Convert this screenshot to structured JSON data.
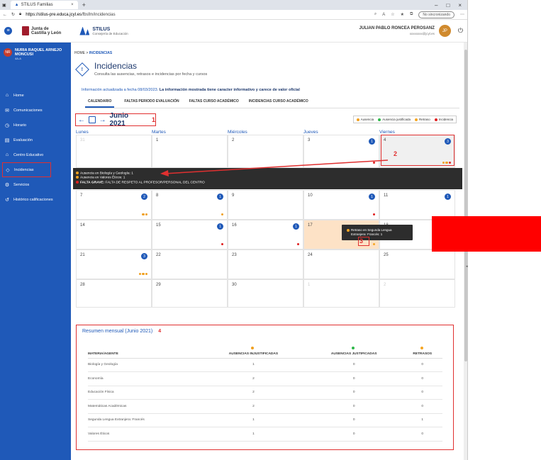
{
  "browser": {
    "tab_title": "STILUS Familias",
    "tab_close": "×",
    "new_tab": "+",
    "url_host": "https://stilus-pre.educa.jcyl.es",
    "url_path": "/fbsfm/incidencias",
    "not_sync": "No sincronizando",
    "win_min": "–",
    "win_max": "□",
    "win_close": "×"
  },
  "header": {
    "org_line1": "Junta de",
    "org_line2": "Castilla y León",
    "app_name": "STILUS",
    "app_sub": "Consejería de Educación",
    "user_name": "JULIAN PABLO RONCEA PEROSANZ",
    "user_email": "xxxxxxxx@jcyl.es",
    "user_initials": "JP"
  },
  "sidebar": {
    "student_initials": "NR",
    "student_name": "NURIA RAQUEL ARNEJO MONCUSI",
    "student_class": "4A-A",
    "items": [
      {
        "label": "Home"
      },
      {
        "label": "Comunicaciones"
      },
      {
        "label": "Horario"
      },
      {
        "label": "Evaluación"
      },
      {
        "label": "Centro Educativo"
      },
      {
        "label": "Incidencias"
      },
      {
        "label": "Servicios"
      },
      {
        "label": "Histórico calificaciones"
      }
    ]
  },
  "main": {
    "breadcrumb_home": "HOME",
    "breadcrumb_sep": ">",
    "breadcrumb_current": "INCIDENCIAS",
    "title": "Incidencias",
    "subtitle": "Consulta las ausencias, retrasos e incidencias por fecha y cursos",
    "info_normal": "Información actualizada a fecha 08/03/2023.",
    "info_bold": "La información mostrada tiene caracter informativo y carece de valor oficial",
    "tabs": [
      {
        "label": "CALENDARIO"
      },
      {
        "label": "FALTAS PERIODO EVALUACIÓN"
      },
      {
        "label": "FALTAS CURSO ACADÉMICO"
      },
      {
        "label": "INCIDENCIAS CURSO ACADÉMICO"
      }
    ],
    "month_label": "Junio 2021",
    "legend": [
      {
        "label": "Ausencia",
        "color": "#f0a020"
      },
      {
        "label": "Ausencia justificada",
        "color": "#2fb84a"
      },
      {
        "label": "Retraso",
        "color": "#f5a623"
      },
      {
        "label": "Incidencia",
        "color": "#e02020"
      }
    ],
    "days": [
      "Lunes",
      "Martes",
      "Miércoles",
      "Jueves",
      "Viernes"
    ],
    "weeks": [
      [
        {
          "d": "31",
          "muted": true
        },
        {
          "d": "1"
        },
        {
          "d": "2"
        },
        {
          "d": "3",
          "badge": "1",
          "dots": [
            "#e02020"
          ]
        },
        {
          "d": "4",
          "badge": "3",
          "dots": [
            "#f0a020",
            "#f0a020",
            "#e02020"
          ],
          "sel": true
        }
      ],
      [
        {
          "d": "7",
          "badge": "2",
          "dots": [
            "#f0a020",
            "#f0a020"
          ]
        },
        {
          "d": "8",
          "badge": "1",
          "dots": [
            "#f0a020"
          ]
        },
        {
          "d": "9"
        },
        {
          "d": "10",
          "badge": "1",
          "dots": [
            "#e02020"
          ]
        },
        {
          "d": "11",
          "badge": "1"
        }
      ],
      [
        {
          "d": "14"
        },
        {
          "d": "15",
          "badge": "1",
          "dots": [
            "#e02020"
          ]
        },
        {
          "d": "16",
          "badge": "1",
          "dots": [
            "#e02020"
          ]
        },
        {
          "d": "17",
          "hl": true,
          "dots": [
            "#f5a623"
          ]
        },
        {
          "d": "18"
        }
      ],
      [
        {
          "d": "21",
          "badge": "3",
          "dots": [
            "#f0a020",
            "#f0a020",
            "#f0a020"
          ]
        },
        {
          "d": "22"
        },
        {
          "d": "23"
        },
        {
          "d": "24"
        },
        {
          "d": "25"
        }
      ],
      [
        {
          "d": "28"
        },
        {
          "d": "29"
        },
        {
          "d": "30"
        },
        {
          "d": "1",
          "muted": true
        },
        {
          "d": "2",
          "muted": true
        }
      ]
    ],
    "popup": {
      "line1": "Ausencia en Biología y Geología: 1",
      "line2": "Ausencia en Valores Éticos: 1",
      "line3_bold": "FALTA GRAVE:",
      "line3_rest": "FALTA DE RESPETO AL PROFESOR/PERSONAL DEL CENTRO"
    },
    "tooltip": {
      "line1": "Retraso en Segunda Lengua",
      "line2": "Extranjera: Francés: 1"
    },
    "annotations": {
      "a1": "1",
      "a2": "2",
      "a3": "3",
      "a4": "4"
    }
  },
  "summary": {
    "title": "Resumen mensual (Junio 2021)",
    "columns": [
      "MATERIA/AGENTE",
      "AUSENCIAS INJUSTIFICADAS",
      "AUSENCIAS JUSTIFICADAS",
      "RETRASOS"
    ],
    "col_colors": [
      "#f0a020",
      "#2fb84a",
      "#f5a623"
    ],
    "rows": [
      [
        "Biología y Geología",
        "1",
        "0",
        "0"
      ],
      [
        "Economía",
        "2",
        "0",
        "0"
      ],
      [
        "Educación Física",
        "2",
        "0",
        "0"
      ],
      [
        "Matemáticas Académicas",
        "2",
        "0",
        "0"
      ],
      [
        "Segunda Lengua Extranjera: Francés",
        "1",
        "0",
        "1"
      ],
      [
        "Valores Éticos",
        "1",
        "0",
        "0"
      ]
    ]
  },
  "overlay": {
    "side_color": "#ff0000"
  }
}
